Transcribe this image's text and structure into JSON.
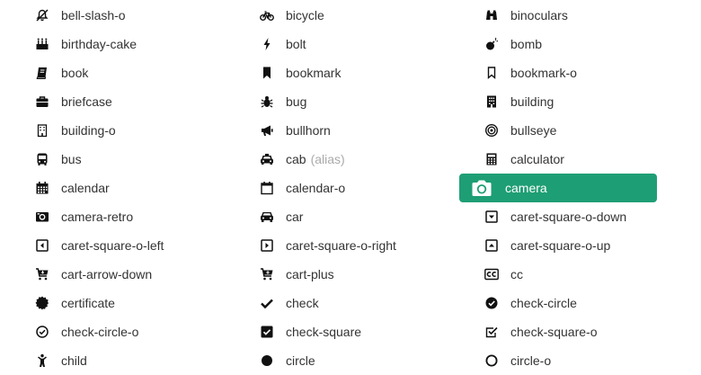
{
  "accent_color": "#1e9e74",
  "icons": [
    {
      "name": "bell-slash-o",
      "icon": "bell-slash-icon"
    },
    {
      "name": "bicycle",
      "icon": "bicycle-icon"
    },
    {
      "name": "binoculars",
      "icon": "binoculars-icon"
    },
    {
      "name": "birthday-cake",
      "icon": "birthday-cake-icon"
    },
    {
      "name": "bolt",
      "icon": "bolt-icon"
    },
    {
      "name": "bomb",
      "icon": "bomb-icon"
    },
    {
      "name": "book",
      "icon": "book-icon"
    },
    {
      "name": "bookmark",
      "icon": "bookmark-icon"
    },
    {
      "name": "bookmark-o",
      "icon": "bookmark-outline-icon"
    },
    {
      "name": "briefcase",
      "icon": "briefcase-icon"
    },
    {
      "name": "bug",
      "icon": "bug-icon"
    },
    {
      "name": "building",
      "icon": "building-icon"
    },
    {
      "name": "building-o",
      "icon": "building-outline-icon"
    },
    {
      "name": "bullhorn",
      "icon": "bullhorn-icon"
    },
    {
      "name": "bullseye",
      "icon": "bullseye-icon"
    },
    {
      "name": "bus",
      "icon": "bus-icon"
    },
    {
      "name": "cab",
      "alias": "(alias)",
      "icon": "cab-icon"
    },
    {
      "name": "calculator",
      "icon": "calculator-icon"
    },
    {
      "name": "calendar",
      "icon": "calendar-icon"
    },
    {
      "name": "calendar-o",
      "icon": "calendar-outline-icon"
    },
    {
      "name": "camera",
      "icon": "camera-icon",
      "active": true
    },
    {
      "name": "camera-retro",
      "icon": "camera-retro-icon"
    },
    {
      "name": "car",
      "icon": "car-icon"
    },
    {
      "name": "caret-square-o-down",
      "icon": "caret-square-down-icon"
    },
    {
      "name": "caret-square-o-left",
      "icon": "caret-square-left-icon"
    },
    {
      "name": "caret-square-o-right",
      "icon": "caret-square-right-icon"
    },
    {
      "name": "caret-square-o-up",
      "icon": "caret-square-up-icon"
    },
    {
      "name": "cart-arrow-down",
      "icon": "cart-arrow-down-icon"
    },
    {
      "name": "cart-plus",
      "icon": "cart-plus-icon"
    },
    {
      "name": "cc",
      "icon": "cc-icon"
    },
    {
      "name": "certificate",
      "icon": "certificate-icon"
    },
    {
      "name": "check",
      "icon": "check-icon"
    },
    {
      "name": "check-circle",
      "icon": "check-circle-icon"
    },
    {
      "name": "check-circle-o",
      "icon": "check-circle-outline-icon"
    },
    {
      "name": "check-square",
      "icon": "check-square-icon"
    },
    {
      "name": "check-square-o",
      "icon": "check-square-outline-icon"
    },
    {
      "name": "child",
      "icon": "child-icon"
    },
    {
      "name": "circle",
      "icon": "circle-icon"
    },
    {
      "name": "circle-o",
      "icon": "circle-outline-icon"
    }
  ]
}
